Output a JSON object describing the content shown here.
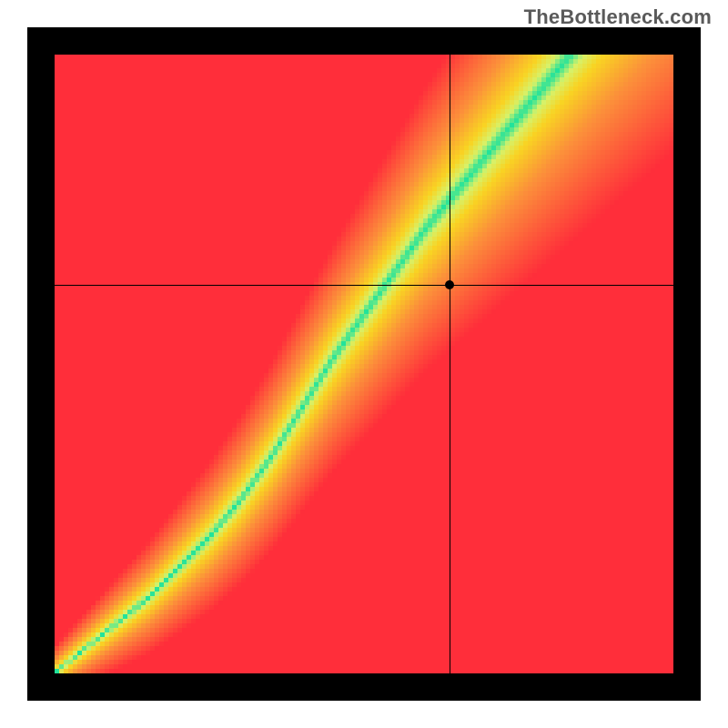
{
  "watermark": "TheBottleneck.com",
  "chart_data": {
    "type": "heatmap",
    "title": "",
    "xlabel": "",
    "ylabel": "",
    "xlim": [
      0,
      1
    ],
    "ylim": [
      0,
      1
    ],
    "grid": false,
    "marker": {
      "x": 0.638,
      "y": 0.628
    },
    "crosshair": {
      "x": 0.638,
      "y": 0.628
    },
    "border_fraction": 0.04,
    "resolution": 148,
    "ridge": {
      "description": "optimal-match curve y = f(x). values are y for x at 0.05 steps",
      "x": [
        0.0,
        0.05,
        0.1,
        0.15,
        0.2,
        0.25,
        0.3,
        0.35,
        0.4,
        0.45,
        0.5,
        0.55,
        0.6,
        0.65,
        0.7,
        0.75,
        0.8,
        0.85,
        0.9,
        0.95,
        1.0
      ],
      "y": [
        0.0,
        0.04,
        0.08,
        0.12,
        0.17,
        0.22,
        0.28,
        0.35,
        0.43,
        0.51,
        0.58,
        0.65,
        0.72,
        0.78,
        0.84,
        0.9,
        0.96,
        1.02,
        1.08,
        1.14,
        1.2
      ]
    },
    "bandwidth": {
      "bottom": 0.015,
      "top": 0.12
    },
    "colors": {
      "peak": "#22e39b",
      "near": "#d7f26a",
      "mid": "#f9d423",
      "warm": "#fc913a",
      "far": "#ff2e3a",
      "border": "#000000"
    }
  }
}
